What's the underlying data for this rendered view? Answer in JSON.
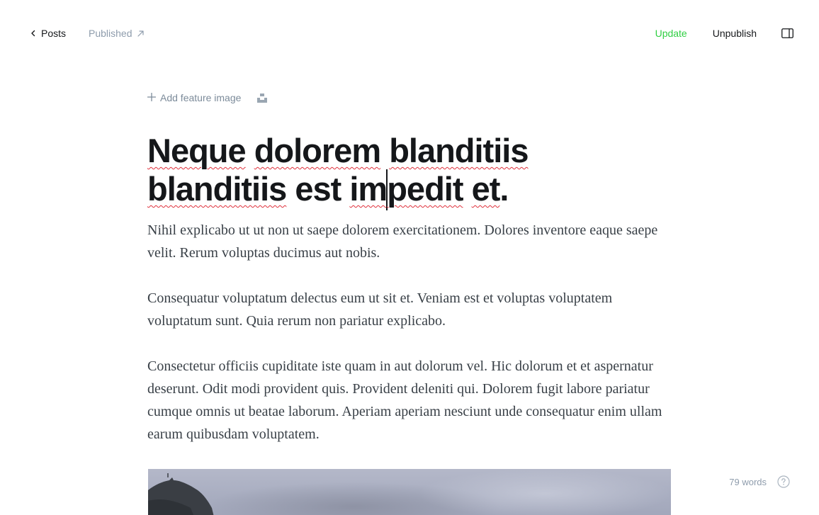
{
  "header": {
    "back_label": "Posts",
    "status_label": "Published",
    "update_label": "Update",
    "unpublish_label": "Unpublish"
  },
  "feature_image": {
    "add_label": "Add feature image"
  },
  "post": {
    "title_words": [
      "Neque",
      "dolorem",
      "blanditiis",
      "blanditiis",
      "est",
      "im",
      "pedit",
      "et",
      "."
    ],
    "paragraphs": [
      "Nihil explicabo ut ut non ut saepe dolorem exercitationem. Dolores inventore eaque saepe velit. Rerum voluptas ducimus aut nobis.",
      "Consequatur voluptatum delectus eum ut sit et. Veniam est et voluptas voluptatem voluptatum sunt. Quia rerum non pariatur explicabo.",
      "Consectetur officiis cupiditate iste quam in aut dolorum vel. Hic dolorum et et aspernatur deserunt. Odit modi provident quis. Provident deleniti qui. Dolorem fugit labore pariatur cumque omnis ut beatae laborum. Aperiam aperiam nesciunt unde consequatur enim ullam earum quibusdam voluptatem."
    ]
  },
  "footer": {
    "word_count": "79 words"
  },
  "colors": {
    "accent_green": "#30cf43",
    "muted_text": "#8e9cac",
    "spellcheck": "#e0303b"
  },
  "icons": {
    "back": "chevron-left-icon",
    "status": "arrow-up-right-icon",
    "sidebar": "sidebar-panel-icon",
    "add": "plus-icon",
    "unsplash": "unsplash-icon",
    "help": "question-circle-icon"
  }
}
